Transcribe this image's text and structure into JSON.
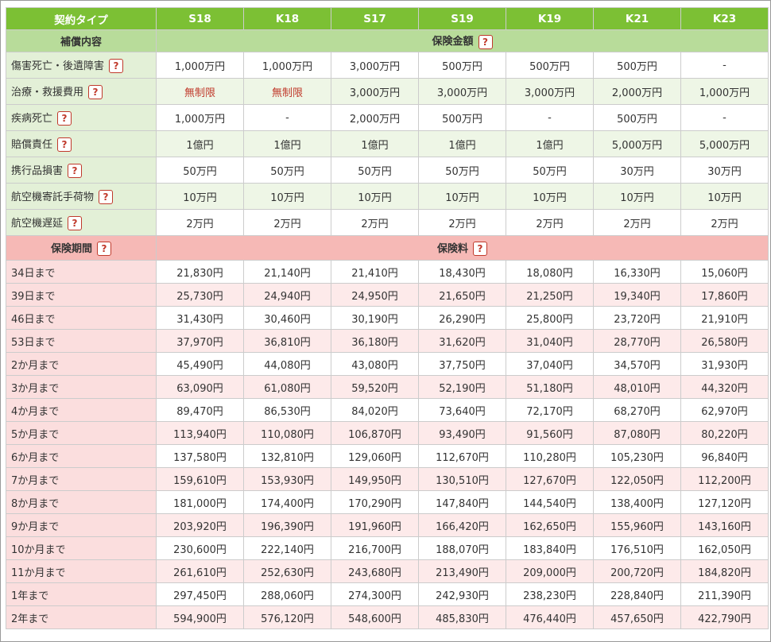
{
  "header": {
    "first": "契約タイプ",
    "plans": [
      "S18",
      "K18",
      "S17",
      "S19",
      "K19",
      "K21",
      "K23"
    ]
  },
  "coverage_section": {
    "left": "補償内容",
    "right": "保険金額"
  },
  "coverage_rows": [
    {
      "label": "傷害死亡・後遺障害",
      "values": [
        "1,000万円",
        "1,000万円",
        "3,000万円",
        "500万円",
        "500万円",
        "500万円",
        "-"
      ]
    },
    {
      "label": "治療・救援費用",
      "values": [
        "無制限",
        "無制限",
        "3,000万円",
        "3,000万円",
        "3,000万円",
        "2,000万円",
        "1,000万円"
      ]
    },
    {
      "label": "疾病死亡",
      "values": [
        "1,000万円",
        "-",
        "2,000万円",
        "500万円",
        "-",
        "500万円",
        "-"
      ]
    },
    {
      "label": "賠償責任",
      "values": [
        "1億円",
        "1億円",
        "1億円",
        "1億円",
        "1億円",
        "5,000万円",
        "5,000万円"
      ]
    },
    {
      "label": "携行品損害",
      "values": [
        "50万円",
        "50万円",
        "50万円",
        "50万円",
        "50万円",
        "30万円",
        "30万円"
      ]
    },
    {
      "label": "航空機寄託手荷物",
      "values": [
        "10万円",
        "10万円",
        "10万円",
        "10万円",
        "10万円",
        "10万円",
        "10万円"
      ]
    },
    {
      "label": "航空機遅延",
      "values": [
        "2万円",
        "2万円",
        "2万円",
        "2万円",
        "2万円",
        "2万円",
        "2万円"
      ]
    }
  ],
  "premium_section": {
    "left": "保険期間",
    "right": "保険料"
  },
  "premium_rows": [
    {
      "label": "34日まで",
      "values": [
        "21,830円",
        "21,140円",
        "21,410円",
        "18,430円",
        "18,080円",
        "16,330円",
        "15,060円"
      ]
    },
    {
      "label": "39日まで",
      "values": [
        "25,730円",
        "24,940円",
        "24,950円",
        "21,650円",
        "21,250円",
        "19,340円",
        "17,860円"
      ]
    },
    {
      "label": "46日まで",
      "values": [
        "31,430円",
        "30,460円",
        "30,190円",
        "26,290円",
        "25,800円",
        "23,720円",
        "21,910円"
      ]
    },
    {
      "label": "53日まで",
      "values": [
        "37,970円",
        "36,810円",
        "36,180円",
        "31,620円",
        "31,040円",
        "28,770円",
        "26,580円"
      ]
    },
    {
      "label": "2か月まで",
      "values": [
        "45,490円",
        "44,080円",
        "43,080円",
        "37,750円",
        "37,040円",
        "34,570円",
        "31,930円"
      ]
    },
    {
      "label": "3か月まで",
      "values": [
        "63,090円",
        "61,080円",
        "59,520円",
        "52,190円",
        "51,180円",
        "48,010円",
        "44,320円"
      ]
    },
    {
      "label": "4か月まで",
      "values": [
        "89,470円",
        "86,530円",
        "84,020円",
        "73,640円",
        "72,170円",
        "68,270円",
        "62,970円"
      ]
    },
    {
      "label": "5か月まで",
      "values": [
        "113,940円",
        "110,080円",
        "106,870円",
        "93,490円",
        "91,560円",
        "87,080円",
        "80,220円"
      ]
    },
    {
      "label": "6か月まで",
      "values": [
        "137,580円",
        "132,810円",
        "129,060円",
        "112,670円",
        "110,280円",
        "105,230円",
        "96,840円"
      ]
    },
    {
      "label": "7か月まで",
      "values": [
        "159,610円",
        "153,930円",
        "149,950円",
        "130,510円",
        "127,670円",
        "122,050円",
        "112,200円"
      ]
    },
    {
      "label": "8か月まで",
      "values": [
        "181,000円",
        "174,400円",
        "170,290円",
        "147,840円",
        "144,540円",
        "138,400円",
        "127,120円"
      ]
    },
    {
      "label": "9か月まで",
      "values": [
        "203,920円",
        "196,390円",
        "191,960円",
        "166,420円",
        "162,650円",
        "155,960円",
        "143,160円"
      ]
    },
    {
      "label": "10か月まで",
      "values": [
        "230,600円",
        "222,140円",
        "216,700円",
        "188,070円",
        "183,840円",
        "176,510円",
        "162,050円"
      ]
    },
    {
      "label": "11か月まで",
      "values": [
        "261,610円",
        "252,630円",
        "243,680円",
        "213,490円",
        "209,000円",
        "200,720円",
        "184,820円"
      ]
    },
    {
      "label": "1年まで",
      "values": [
        "297,450円",
        "288,060円",
        "274,300円",
        "242,930円",
        "238,230円",
        "228,840円",
        "211,390円"
      ]
    },
    {
      "label": "2年まで",
      "values": [
        "594,900円",
        "576,120円",
        "548,600円",
        "485,830円",
        "476,440円",
        "457,650円",
        "422,790円"
      ]
    }
  ],
  "help_glyph": "?",
  "colors": {
    "header_green": "#7cc034",
    "coverage_header": "#b8dc9a",
    "premium_header": "#f6b9b6",
    "unlimited_red": "#c0392b"
  }
}
